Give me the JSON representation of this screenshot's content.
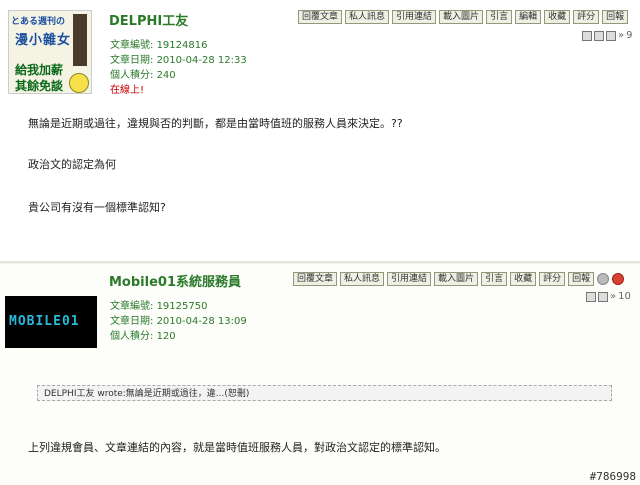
{
  "posts": [
    {
      "author": "DELPHI工友",
      "avatar_text": [
        "とある週刊の",
        "漫小雜女",
        "給我加薪",
        "其餘免談"
      ],
      "meta": {
        "article_id_label": "文章編號:",
        "article_id": "19124816",
        "date_label": "文章日期:",
        "date": "2010-04-28 12:33",
        "score_label": "個人積分:",
        "score": "240",
        "online": "在線上!"
      },
      "buttons": [
        "回覆文章",
        "私人訊息",
        "引用連結",
        "載入圖片",
        "引言",
        "編輯",
        "收藏",
        "評分",
        "回報"
      ],
      "floor": "9",
      "body": [
        "無論是近期或過往，違規與否的判斷，都是由當時值班的服務人員來決定。??",
        "政治文的認定為何",
        "貴公司有沒有一個標準認知?"
      ]
    },
    {
      "author": "Mobile01系統服務員",
      "avatar_text": "MOBILE01",
      "meta": {
        "article_id_label": "文章編號:",
        "article_id": "19125750",
        "date_label": "文章日期:",
        "date": "2010-04-28 13:09",
        "score_label": "個人積分:",
        "score": "120"
      },
      "buttons": [
        "回覆文章",
        "私人訊息",
        "引用連結",
        "載入圖片",
        "引言",
        "收藏",
        "評分",
        "回報"
      ],
      "floor": "10",
      "quote": "DELPHI工友 wrote:無論是近期或過往，違...(恕刪)",
      "body": [
        "上列違規會員、文章連結的內容，就是當時值班服務人員，對政治文認定的標準認知。"
      ]
    }
  ],
  "watermark": "#786998"
}
